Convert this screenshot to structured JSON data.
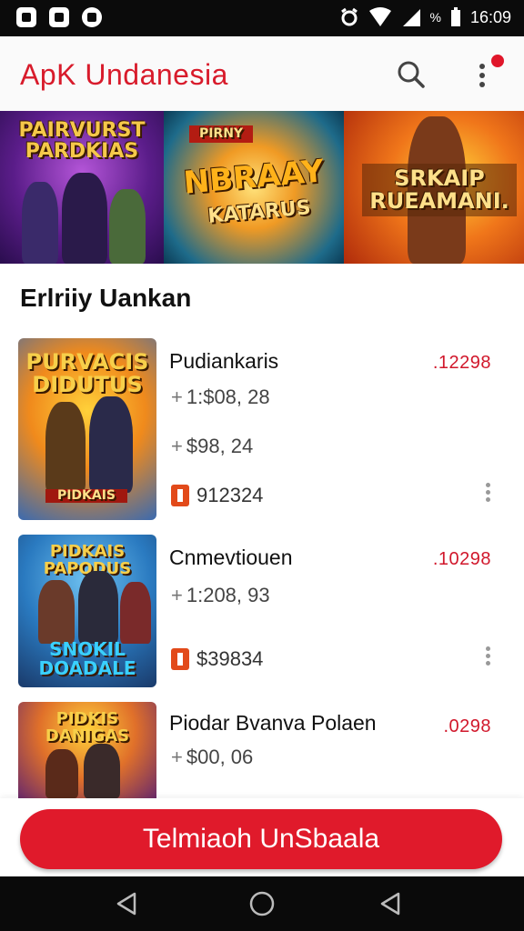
{
  "status_bar": {
    "time": "16:09",
    "battery_text": "%"
  },
  "app_bar": {
    "title": "ApK Undanesia",
    "search_icon": "search-icon",
    "menu_icon": "more-vert-icon"
  },
  "banner": {
    "panels": [
      {
        "title": "PAIRVURST PARDKIAS"
      },
      {
        "tag": "PIRNY",
        "title": "NBRAAY",
        "subtitle": "KATARUS"
      },
      {
        "title": "SRKAIP RUEAMANI."
      }
    ]
  },
  "section": {
    "title": "Erlriiy Uankan"
  },
  "items": [
    {
      "thumb_title": "PURVACIS DIDUTUS",
      "thumb_sub": "PIDKAIS",
      "name": "Pudiankaris",
      "price": ".12298",
      "meta1": "1:$08, 28",
      "meta2": "$98, 24",
      "tag_value": "912324"
    },
    {
      "thumb_title": "PIDKAIS PAPODUS",
      "thumb_sub": "SNOKIL DOADALE",
      "name": "Cnmevtiouen",
      "price": ".10298",
      "tag_value": "$39834",
      "meta1": "1:208, 93"
    },
    {
      "thumb_title": "PIDKIS DANIGAS",
      "name": "Piodar Bvanva Polaen",
      "price": ".0298",
      "meta1": "$00, 06"
    }
  ],
  "cta": {
    "label": "Telmiaoh UnSbaala"
  },
  "colors": {
    "accent": "#e01a2b",
    "title_red": "#d81b2b"
  }
}
